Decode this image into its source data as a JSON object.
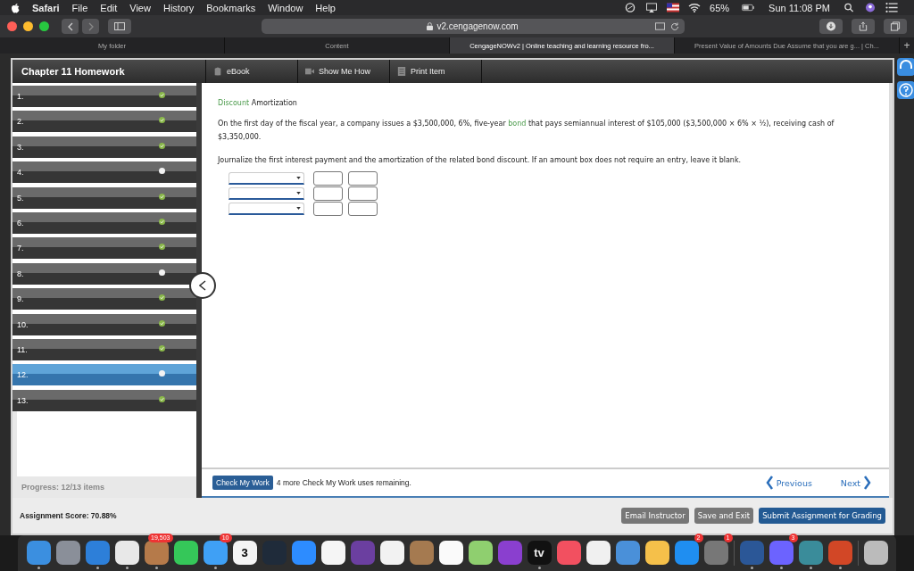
{
  "menu_bar": {
    "app": "Safari",
    "items": [
      "File",
      "Edit",
      "View",
      "History",
      "Bookmarks",
      "Window",
      "Help"
    ],
    "battery": "65%",
    "clock": "Sun 11:08 PM"
  },
  "toolbar": {
    "address": "v2.cengagenow.com",
    "new_tab": "+"
  },
  "tabs": [
    {
      "label": "My folder",
      "selected": false
    },
    {
      "label": "Content",
      "selected": false
    },
    {
      "label": "CengageNOWv2 | Online teaching and learning resource fro...",
      "selected": true
    },
    {
      "label": "Present Value of Amounts Due Assume that you are g... | Ch...",
      "selected": false
    }
  ],
  "header": {
    "title": "Chapter 11 Homework",
    "tools": [
      {
        "kind": "book",
        "label": "eBook"
      },
      {
        "kind": "video",
        "label": "Show Me How"
      },
      {
        "kind": "print",
        "label": "Print Item"
      }
    ]
  },
  "sidebar": {
    "items": [
      {
        "label": "1.",
        "complete": true,
        "selected": false
      },
      {
        "label": "2.",
        "complete": true,
        "selected": false
      },
      {
        "label": "3.",
        "complete": true,
        "selected": false
      },
      {
        "label": "4.",
        "complete": false,
        "selected": false
      },
      {
        "label": "5.",
        "complete": true,
        "selected": false
      },
      {
        "label": "6.",
        "complete": true,
        "selected": false
      },
      {
        "label": "7.",
        "complete": true,
        "selected": false
      },
      {
        "label": "8.",
        "complete": false,
        "selected": false
      },
      {
        "label": "9.",
        "complete": true,
        "selected": false
      },
      {
        "label": "10.",
        "complete": true,
        "selected": false
      },
      {
        "label": "11.",
        "complete": true,
        "selected": false
      },
      {
        "label": "12.",
        "complete": false,
        "selected": true
      },
      {
        "label": "13.",
        "complete": true,
        "selected": false
      }
    ],
    "progress": "Progress:  12/13 items"
  },
  "question": {
    "title": [
      {
        "kind": "link",
        "text": "Discount"
      },
      {
        "kind": "text",
        "text": " Amortization"
      }
    ],
    "paragraph": [
      {
        "kind": "text",
        "text": "On the first day of the fiscal year, a company issues a $3,500,000, 6%, five-year "
      },
      {
        "kind": "link",
        "text": "bond"
      },
      {
        "kind": "text",
        "text": " that pays semiannual interest of $105,000 ($3,500,000 × 6% × ½), receiving cash of $3,350,000."
      }
    ],
    "instruction": "Journalize the first interest payment and the amortization of the related bond discount. If an amount box does not require an entry, leave it blank."
  },
  "footer": {
    "check_button": "Check My Work",
    "remaining": "4 more Check My Work uses remaining.",
    "previous": "Previous",
    "next": "Next"
  },
  "score_bar": {
    "score": "Assignment Score:   70.88%",
    "buttons": [
      {
        "kind": "gray",
        "label": "Email Instructor"
      },
      {
        "kind": "gray",
        "label": "Save and Exit"
      },
      {
        "kind": "primary",
        "label": "Submit Assignment for Grading"
      }
    ]
  },
  "dock": {
    "items": [
      {
        "color": "#3b8fe0",
        "running": true
      },
      {
        "color": "#8a8f99",
        "running": false
      },
      {
        "color": "#2d7fd9",
        "running": true
      },
      {
        "color": "#e8e8e8",
        "running": true
      },
      {
        "color": "#b57a4a",
        "running": true,
        "badge": "19,503"
      },
      {
        "color": "#35c759",
        "running": false
      },
      {
        "color": "#3fa0f5",
        "running": true,
        "badge": "10"
      },
      {
        "color": "#f4f4f4",
        "running": false,
        "label": "3"
      },
      {
        "color": "#1f2b3a",
        "running": false
      },
      {
        "color": "#2d8cff",
        "running": false
      },
      {
        "color": "#f5f5f5",
        "running": false
      },
      {
        "color": "#6b3fa0",
        "running": false
      },
      {
        "color": "#f2f2f2",
        "running": false
      },
      {
        "color": "#a57a50",
        "running": false
      },
      {
        "color": "#fafafa",
        "running": false
      },
      {
        "color": "#8fcf6f",
        "running": false
      },
      {
        "color": "#8a3fcf",
        "running": false
      },
      {
        "color": "#111111",
        "running": true,
        "label": "tv"
      },
      {
        "color": "#f25060",
        "running": false
      },
      {
        "color": "#f0f0f0",
        "running": false
      },
      {
        "color": "#4a90d9",
        "running": false
      },
      {
        "color": "#f5c04a",
        "running": false
      },
      {
        "color": "#1f8ef1",
        "running": false,
        "badge": "2"
      },
      {
        "color": "#777777",
        "running": false,
        "badge": "1"
      },
      {
        "color": "#2b5797",
        "running": true,
        "separator": true
      },
      {
        "color": "#6c63ff",
        "running": true,
        "badge": "3"
      },
      {
        "color": "#3a8c9a",
        "running": true
      },
      {
        "color": "#d24726",
        "running": true
      },
      {
        "color": "#bbbbbb",
        "running": false,
        "separator": true
      }
    ]
  }
}
